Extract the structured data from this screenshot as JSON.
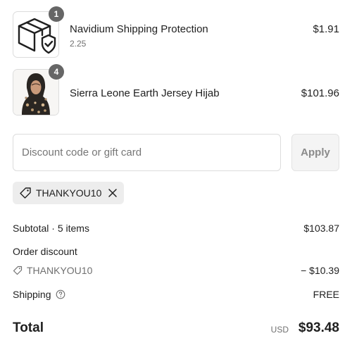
{
  "line_items": [
    {
      "quantity": "1",
      "name": "Navidium Shipping Protection",
      "variant": "2.25",
      "price": "$1.91",
      "icon": "box-shield-icon"
    },
    {
      "quantity": "4",
      "name": "Sierra Leone Earth Jersey Hijab",
      "price": "$101.96",
      "icon": "product-photo"
    }
  ],
  "discount": {
    "placeholder": "Discount code or gift card",
    "apply_label": "Apply",
    "applied_code": "THANKYOU10"
  },
  "summary": {
    "subtotal_label": "Subtotal · 5 items",
    "subtotal_value": "$103.87",
    "order_discount_label": "Order discount",
    "discount_code": "THANKYOU10",
    "discount_value": "− $10.39",
    "shipping_label": "Shipping",
    "shipping_value": "FREE",
    "total_label": "Total",
    "currency": "USD",
    "total_value": "$93.48"
  },
  "colors": {
    "badge": "#666666",
    "chip_background": "#ededed",
    "border": "#dcdcdc",
    "apply_background": "#f4f4f4"
  }
}
